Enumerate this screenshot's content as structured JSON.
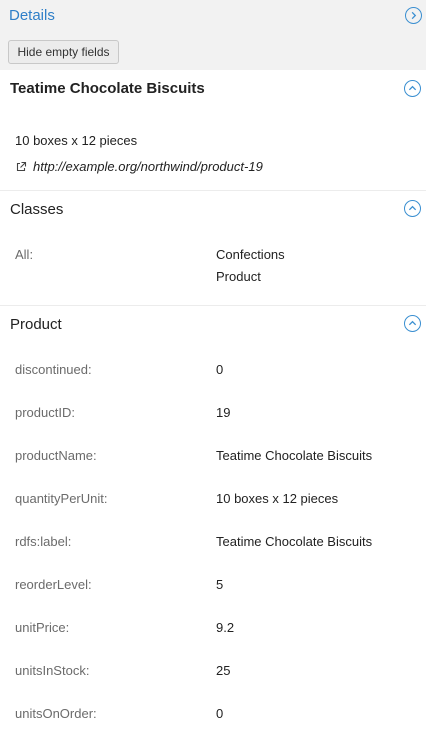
{
  "header": {
    "title": "Details",
    "hide_empty_label": "Hide empty fields"
  },
  "resource": {
    "title": "Teatime Chocolate Biscuits",
    "subtitle": "10 boxes x 12 pieces",
    "uri": "http://example.org/northwind/product-19"
  },
  "classes": {
    "title": "Classes",
    "label": "All:",
    "values": [
      "Confections",
      "Product"
    ]
  },
  "product": {
    "title": "Product",
    "fields": [
      {
        "label": "discontinued:",
        "value": "0"
      },
      {
        "label": "productID:",
        "value": "19"
      },
      {
        "label": "productName:",
        "value": "Teatime Chocolate Biscuits"
      },
      {
        "label": "quantityPerUnit:",
        "value": "10 boxes x 12 pieces"
      },
      {
        "label": "rdfs:label:",
        "value": "Teatime Chocolate Biscuits"
      },
      {
        "label": "reorderLevel:",
        "value": "5"
      },
      {
        "label": "unitPrice:",
        "value": "9.2"
      },
      {
        "label": "unitsInStock:",
        "value": "25"
      },
      {
        "label": "unitsOnOrder:",
        "value": "0"
      }
    ]
  },
  "colors": {
    "accent": "#3a8fd1",
    "header_bg": "#f2f2f2"
  }
}
